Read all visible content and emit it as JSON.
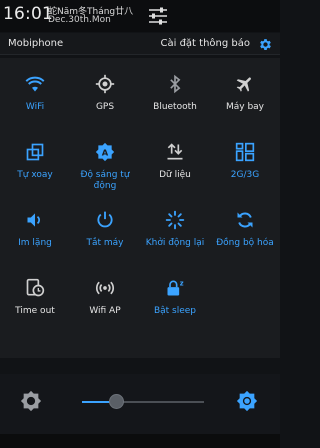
{
  "status": {
    "time": "16:01",
    "lunar_date": "蛇Năm冬Tháng廿八",
    "date": "Dec.30th.Mon"
  },
  "header": {
    "carrier": "Mobiphone",
    "notification_settings_label": "Cài đặt thông báo"
  },
  "tiles": [
    {
      "label": "WiFi",
      "icon": "wifi-icon",
      "active": true
    },
    {
      "label": "GPS",
      "icon": "gps-icon",
      "active": false
    },
    {
      "label": "Bluetooth",
      "icon": "bluetooth-icon",
      "active": false
    },
    {
      "label": "Máy bay",
      "icon": "airplane-icon",
      "active": false
    },
    {
      "label": "Tự xoay",
      "icon": "auto-rotate-icon",
      "active": true
    },
    {
      "label": "Độ sáng tự động",
      "icon": "auto-brightness-icon",
      "active": true
    },
    {
      "label": "Dữ liệu",
      "icon": "mobile-data-icon",
      "active": false
    },
    {
      "label": "2G/3G",
      "icon": "network-mode-icon",
      "active": true
    },
    {
      "label": "Im lặng",
      "icon": "volume-icon",
      "active": true
    },
    {
      "label": "Tắt máy",
      "icon": "power-icon",
      "active": true
    },
    {
      "label": "Khởi động lại",
      "icon": "reboot-icon",
      "active": true
    },
    {
      "label": "Đồng bộ hóa",
      "icon": "sync-icon",
      "active": true
    },
    {
      "label": "Time out",
      "icon": "screen-timeout-icon",
      "active": false
    },
    {
      "label": "Wifi AP",
      "icon": "hotspot-icon",
      "active": false
    },
    {
      "label": "Bật sleep",
      "icon": "sleep-icon",
      "active": true
    }
  ],
  "brightness": {
    "level": 0.29
  },
  "colors": {
    "accent": "#3ba3ff",
    "inactive_icon": "#d0d0d0",
    "background": "#1a1c1f"
  }
}
